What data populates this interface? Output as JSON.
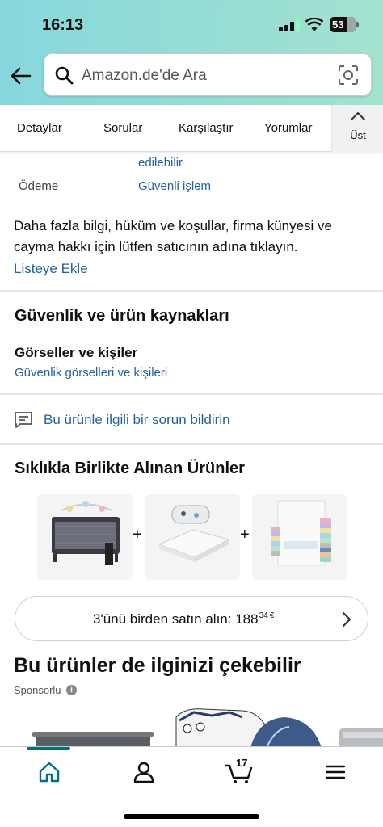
{
  "status_bar": {
    "time": "16:13",
    "battery": "53"
  },
  "search": {
    "placeholder": "Amazon.de'de Ara"
  },
  "tabs": [
    {
      "label": "Detaylar"
    },
    {
      "label": "Sorular"
    },
    {
      "label": "Karşılaştır"
    },
    {
      "label": "Yorumlar"
    },
    {
      "label": "Üst"
    }
  ],
  "details": {
    "partial_value": "edilebilir",
    "payment_label": "Ödeme",
    "payment_value": "Güvenli işlem"
  },
  "seller_info": "Daha fazla bilgi, hüküm ve koşullar, firma künyesi ve cayma hakkı için lütfen satıcının adına tıklayın.",
  "add_to_list": "Listeye Ekle",
  "safety": {
    "title": "Güvenlik ve ürün kaynakları",
    "subtitle": "Görseller ve kişiler",
    "link": "Güvenlik görselleri ve kişileri"
  },
  "report_issue": "Bu ürünle ilgili bir sorun bildirin",
  "bought_together": {
    "title": "Sıklıkla Birlikte Alınan Ürünler",
    "products": [
      "travel-cot",
      "mattress",
      "fitted-sheets"
    ],
    "buy_all_label": "3'ünü birden satın alın: ",
    "price_whole": "188",
    "price_fraction": "34",
    "price_currency": "€"
  },
  "recommendations": {
    "title": "Bu ürünler de ilginizi çekebilir",
    "sponsored": "Sponsorlu",
    "info_glyph": "i"
  },
  "bottom_nav": {
    "items": [
      "home-icon",
      "account-icon",
      "cart-icon",
      "menu-icon"
    ],
    "cart_count": "17"
  },
  "colors": {
    "accent": "#007185",
    "link": "#2162a1",
    "header_start": "#86d7dd",
    "header_end": "#a3e2cf"
  }
}
